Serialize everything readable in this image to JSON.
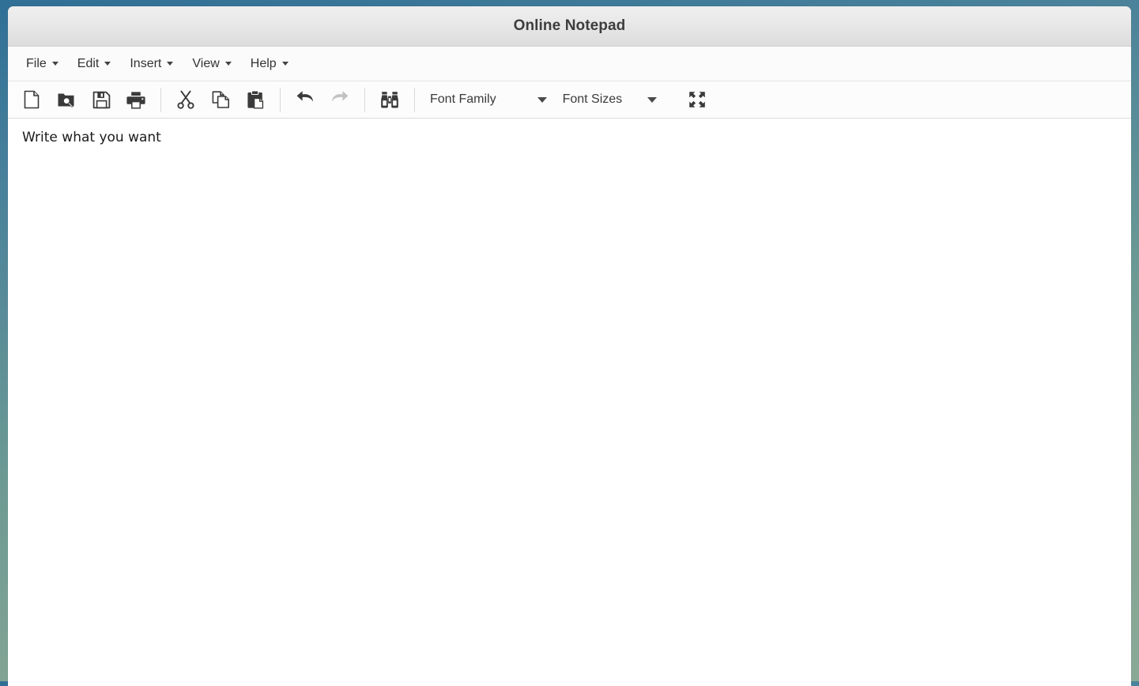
{
  "window": {
    "title": "Online Notepad"
  },
  "colors": {
    "page_background_top": "#2f6f96",
    "page_background_bottom": "#8aa896",
    "titlebar_background": "#e8e8e8",
    "title_text": "#3d3d3d",
    "toolbar_background": "#fcfcfc",
    "icon": "#3a3a3a",
    "icon_disabled": "#c2c2c2",
    "editor_background": "#ffffff",
    "editor_text": "#1a1a1a"
  },
  "menubar": {
    "items": [
      {
        "label": "File",
        "icon": "chevron-down-icon"
      },
      {
        "label": "Edit",
        "icon": "chevron-down-icon"
      },
      {
        "label": "Insert",
        "icon": "chevron-down-icon"
      },
      {
        "label": "View",
        "icon": "chevron-down-icon"
      },
      {
        "label": "Help",
        "icon": "chevron-down-icon"
      }
    ]
  },
  "toolbar": {
    "buttons": [
      {
        "name": "new-document-icon",
        "title": "New"
      },
      {
        "name": "open-file-icon",
        "title": "Open"
      },
      {
        "name": "save-icon",
        "title": "Save"
      },
      {
        "name": "print-icon",
        "title": "Print"
      },
      {
        "name": "cut-icon",
        "title": "Cut"
      },
      {
        "name": "copy-icon",
        "title": "Copy"
      },
      {
        "name": "paste-icon",
        "title": "Paste"
      },
      {
        "name": "undo-icon",
        "title": "Undo"
      },
      {
        "name": "redo-icon",
        "title": "Redo",
        "state": "disabled"
      },
      {
        "name": "find-binoculars-icon",
        "title": "Find"
      },
      {
        "name": "fullscreen-icon",
        "title": "Fullscreen"
      }
    ],
    "font_family": {
      "label": "Font Family",
      "caret_icon": "chevron-down-icon"
    },
    "font_sizes": {
      "label": "Font Sizes",
      "caret_icon": "chevron-down-icon"
    }
  },
  "editor": {
    "content": "Write what you want",
    "placeholder": "Write what you want"
  }
}
